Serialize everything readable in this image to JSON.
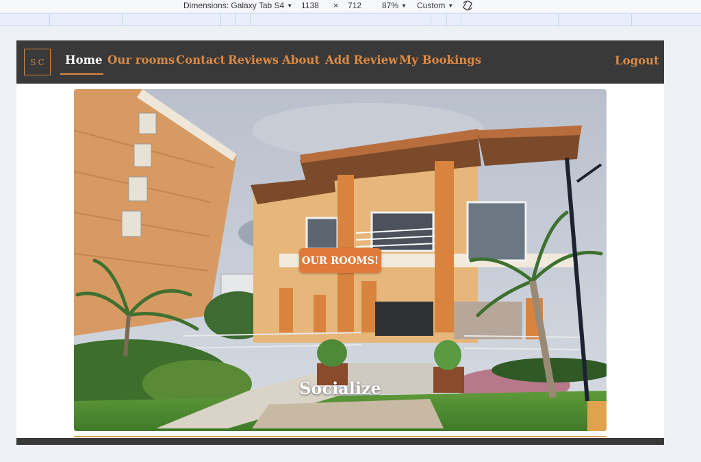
{
  "devtools": {
    "dimensions_label": "Dimensions: Galaxy Tab S4",
    "width": "1138",
    "times": "×",
    "height": "712",
    "zoom": "87%",
    "throttle": "Custom",
    "rotate_icon": "rotate-icon"
  },
  "navbar": {
    "logo_text": "SC",
    "links": [
      {
        "label": "Home",
        "active": true
      },
      {
        "label": "Our rooms"
      },
      {
        "label": "Contact"
      },
      {
        "label": "Reviews"
      },
      {
        "label": "About"
      },
      {
        "label": "Add Review"
      },
      {
        "label": "My Bookings"
      }
    ],
    "logout_label": "Logout"
  },
  "hero": {
    "button_label": "OUR ROOMS!",
    "caption": "Socialize"
  },
  "colors": {
    "navbar_bg": "#393939",
    "accent": "#dd8a45",
    "button": "#e07a3a"
  }
}
